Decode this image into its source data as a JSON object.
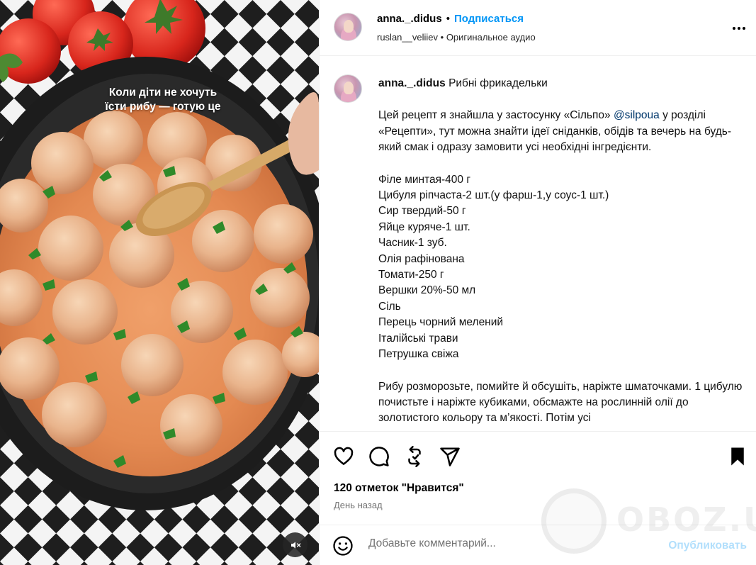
{
  "media": {
    "overlay_line1": "Коли діти не хочуть",
    "overlay_line2": "їсти рибу — готую це"
  },
  "header": {
    "username": "anna._.didus",
    "separator": "•",
    "follow_label": "Подписаться",
    "audio_author": "ruslan__veliiev",
    "audio_label": "Оригинальное аудио"
  },
  "post": {
    "username": "anna._.didus",
    "title": "Рибні фрикадельки",
    "intro_before": "Цей рецепт я знайшла у застосунку «Сільпо» ",
    "mention": "@silpoua",
    "intro_after": " у розділі «Рецепти», тут можна знайти ідеї сніданків, обідів та вечерь на будь-який смак і одразу замовити усі необхідні інгредієнти.",
    "ingredients": [
      "Філе минтая-400 г",
      "Цибуля ріпчаста-2 шт.(у фарш-1,у соус-1 шт.)",
      "Сир твердий-50 г",
      "Яйце куряче-1 шт.",
      "Часник-1 зуб.",
      "Олія рафінована",
      "Томати-250 г",
      "Вершки 20%-50 мл",
      "Сіль",
      "Перець чорний мелений",
      "Італійські трави",
      "Петрушка свіжа"
    ],
    "steps": "Рибу розморозьте, помийте й обсушіть, наріжте шматочками. 1 цибулю почистьте і наріжте кубиками, обсмажте на рослинній олії до золотистого кольору та м’якості. Потім усі"
  },
  "actions": {
    "likes": "120 отметок \"Нравится\"",
    "date": "День назад"
  },
  "comment": {
    "placeholder": "Добавьте комментарий...",
    "publish_label": "Опубликовать"
  },
  "watermark": {
    "text": "OBOZ.UA"
  },
  "icons": {
    "like": "heart-icon",
    "comment": "comment-icon",
    "repost": "repost-icon",
    "share": "share-icon",
    "save": "bookmark-icon",
    "more": "more-icon",
    "mute": "muted-speaker-icon",
    "emoji": "emoji-icon"
  },
  "colors": {
    "accent": "#0095f6",
    "mention": "#00376b",
    "publish_disabled": "#b2dffc",
    "secondary_text": "#737373"
  }
}
